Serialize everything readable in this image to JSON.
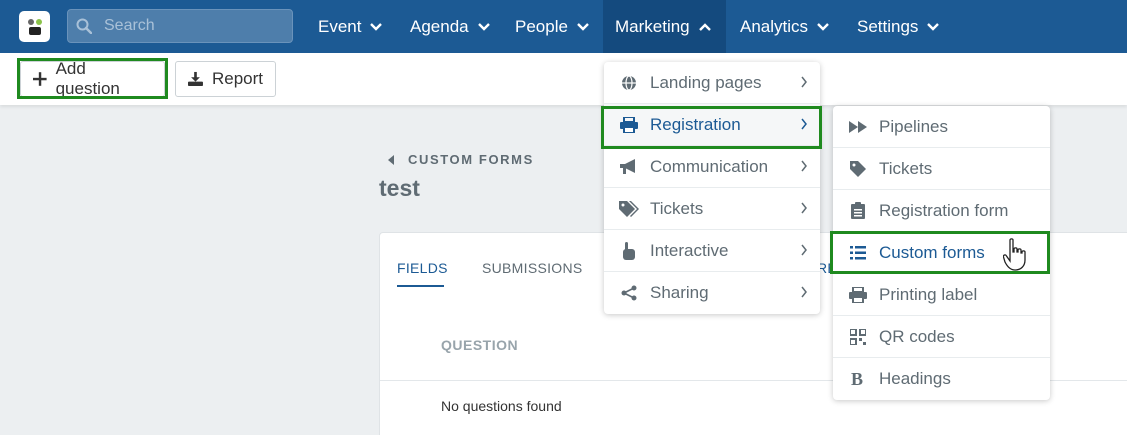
{
  "nav": {
    "search_placeholder": "Search",
    "items": [
      {
        "label": "Event"
      },
      {
        "label": "Agenda"
      },
      {
        "label": "People"
      },
      {
        "label": "Marketing"
      },
      {
        "label": "Analytics"
      },
      {
        "label": "Settings"
      }
    ]
  },
  "toolbar": {
    "add_question_label": "Add question",
    "report_label": "Report"
  },
  "page": {
    "breadcrumb": "CUSTOM FORMS",
    "title": "test",
    "tabs": [
      {
        "label": "FIELDS"
      },
      {
        "label": "SUBMISSIONS"
      },
      {
        "label": "RE"
      }
    ],
    "table": {
      "column_question": "QUESTION",
      "empty_text": "No questions found"
    }
  },
  "marketing_menu": {
    "items": [
      {
        "label": "Landing pages",
        "icon": "globe-icon"
      },
      {
        "label": "Registration",
        "icon": "printer-icon"
      },
      {
        "label": "Communication",
        "icon": "megaphone-icon"
      },
      {
        "label": "Tickets",
        "icon": "tags-icon"
      },
      {
        "label": "Interactive",
        "icon": "hand-pointer-icon"
      },
      {
        "label": "Sharing",
        "icon": "share-icon"
      }
    ]
  },
  "registration_menu": {
    "items": [
      {
        "label": "Pipelines",
        "icon": "fast-forward-icon"
      },
      {
        "label": "Tickets",
        "icon": "tag-icon"
      },
      {
        "label": "Registration form",
        "icon": "clipboard-icon"
      },
      {
        "label": "Custom forms",
        "icon": "list-icon"
      },
      {
        "label": "Printing label",
        "icon": "printer-icon"
      },
      {
        "label": "QR codes",
        "icon": "qrcode-icon"
      },
      {
        "label": "Headings",
        "icon": "bold-icon"
      }
    ]
  },
  "colors": {
    "nav_bg": "#1c5a94",
    "highlight": "#1f8a1f",
    "accent": "#1c5a94"
  }
}
